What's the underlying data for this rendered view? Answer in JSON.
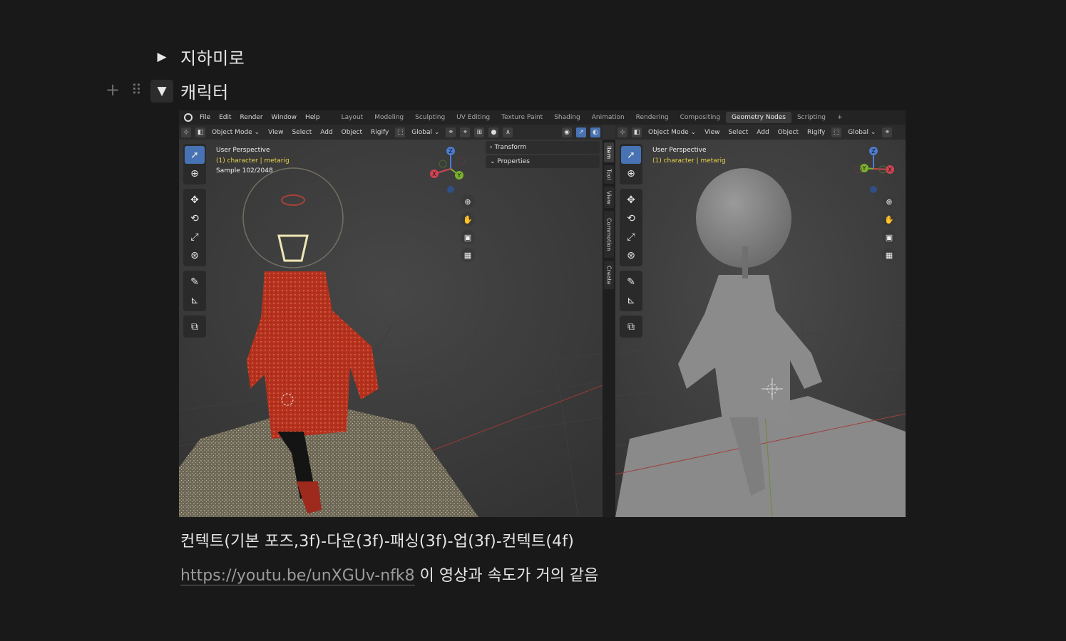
{
  "toggles": [
    {
      "title": "지하미로",
      "expanded": false
    },
    {
      "title": "캐릭터",
      "expanded": true
    }
  ],
  "blender": {
    "menus": [
      "File",
      "Edit",
      "Render",
      "Window",
      "Help"
    ],
    "workspaces": [
      "Layout",
      "Modeling",
      "Sculpting",
      "UV Editing",
      "Texture Paint",
      "Shading",
      "Animation",
      "Rendering",
      "Compositing",
      "Geometry Nodes",
      "Scripting",
      "+"
    ],
    "active_workspace": "Geometry Nodes",
    "left_header": [
      "Object Mode ⌄",
      "View",
      "Select",
      "Add",
      "Object",
      "Rigify",
      "Global ⌄"
    ],
    "right_header": [
      "Object Mode ⌄",
      "View",
      "Select",
      "Add",
      "Object",
      "Rigify",
      "Global ⌄"
    ],
    "left_overlay": {
      "line1": "User Perspective",
      "line2": "(1) character | metarig",
      "line3": "Sample 102/2048"
    },
    "right_overlay": {
      "line1": "User Perspective",
      "line2": "(1) character | metarig"
    },
    "npanel_rows": [
      "Transform",
      "Properties"
    ],
    "side_tabs": [
      "Item",
      "Tool",
      "View",
      "Commotion",
      "Create"
    ],
    "gizmo_axes": {
      "x": "X",
      "y": "Y",
      "z": "Z"
    }
  },
  "caption": "컨텍트(기본 포즈,3f)-다운(3f)-패싱(3f)-업(3f)-컨텍트(4f)",
  "link": {
    "url_text": "https://youtu.be/unXGUv-nfk8",
    "after": " 이 영상과 속도가 거의 같음"
  },
  "colors": {
    "accent_blue": "#4772b3",
    "coat_red": "#b6311e",
    "overlay_yellow": "#e8d24a"
  }
}
